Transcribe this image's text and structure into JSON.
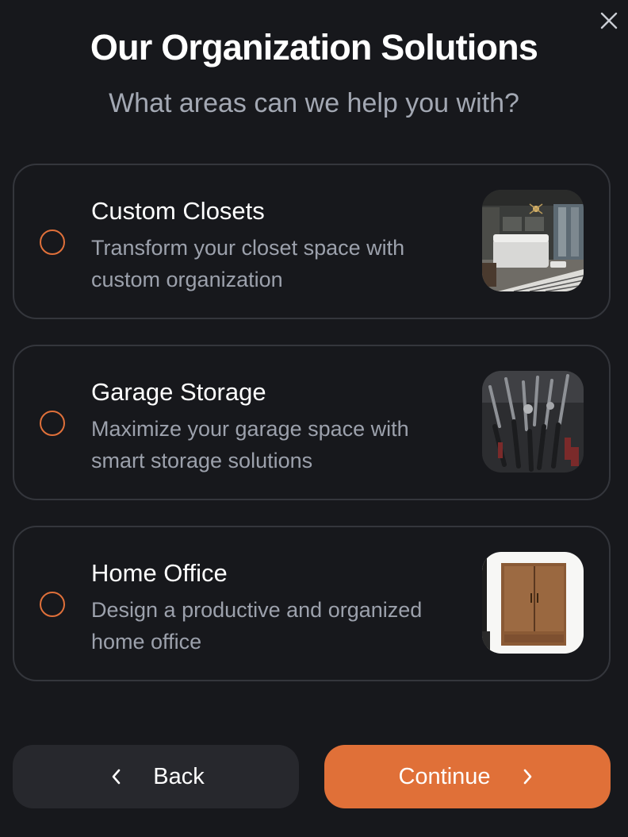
{
  "header": {
    "title": "Our Organization Solutions",
    "subtitle": "What areas can we help you with?",
    "close_icon": "close-icon"
  },
  "options": [
    {
      "title": "Custom Closets",
      "description": "Transform your closet space with custom organization",
      "selected": false,
      "image": "bedroom-closet-photo"
    },
    {
      "title": "Garage Storage",
      "description": "Maximize your garage space with smart storage solutions",
      "selected": false,
      "image": "garage-tools-photo"
    },
    {
      "title": "Home Office",
      "description": "Design a productive and organized home office",
      "selected": false,
      "image": "wooden-wardrobe-photo"
    }
  ],
  "footer": {
    "back_label": "Back",
    "back_icon": "chevron-left-icon",
    "continue_label": "Continue",
    "continue_icon": "chevron-right-icon"
  },
  "colors": {
    "background": "#17181c",
    "accent": "#e07038",
    "card_border": "#34363c",
    "muted_text": "#9ca1ac"
  }
}
